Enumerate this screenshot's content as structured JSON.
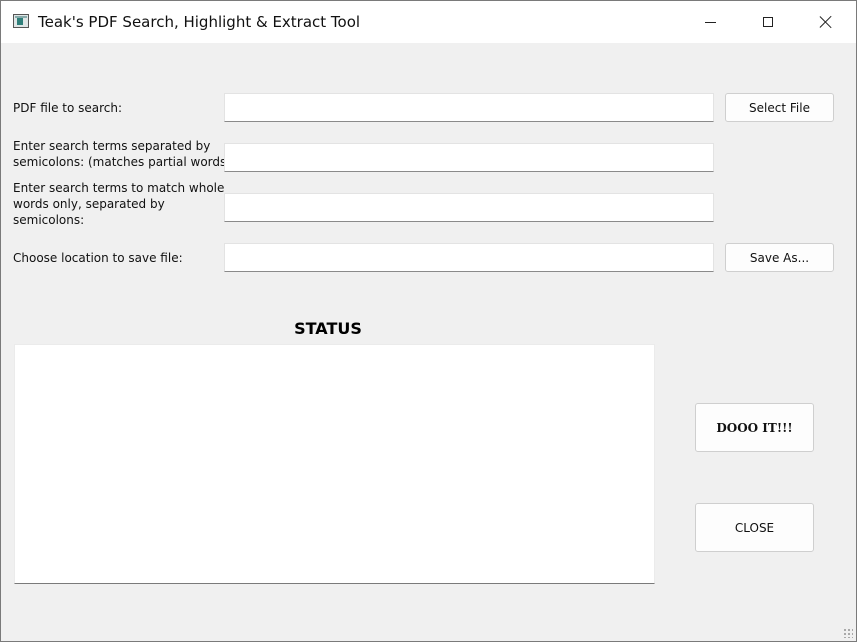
{
  "window": {
    "title": "Teak's PDF Search, Highlight & Extract Tool"
  },
  "form": {
    "pdf_file_label": "PDF file to search:",
    "pdf_file_value": "",
    "select_file_button": "Select File",
    "partial_terms_label_line1": "Enter search terms separated by",
    "partial_terms_label_line2": "semicolons: (matches partial words)",
    "partial_terms_value": "",
    "whole_terms_label_line1": "Enter search terms to match whole",
    "whole_terms_label_line2": "words only, separated by",
    "whole_terms_label_line3": "semicolons:",
    "whole_terms_value": "",
    "save_location_label": "Choose location to save file:",
    "save_location_value": "",
    "save_as_button": "Save As..."
  },
  "status": {
    "title": "STATUS",
    "content": ""
  },
  "actions": {
    "run_button": "DOOO IT!!!",
    "close_button": "CLOSE"
  },
  "icons": {
    "app": "app-icon",
    "minimize": "minimize-icon",
    "maximize": "maximize-icon",
    "close": "close-icon",
    "resize_grip": "resize-grip-icon"
  }
}
